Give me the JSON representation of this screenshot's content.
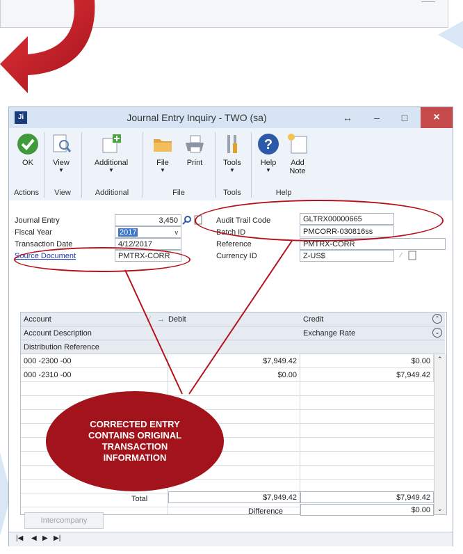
{
  "window": {
    "title": "Journal Entry Inquiry  -  TWO (sa)",
    "app_icon": "Ji",
    "controls": {
      "resize": "↔",
      "minimize": "–",
      "maximize": "□",
      "close": "×"
    }
  },
  "ribbon": {
    "items": [
      {
        "id": "ok",
        "label": "OK",
        "icon": "checkmark-icon"
      },
      {
        "id": "view",
        "label": "View",
        "icon": "magnifier-document-icon"
      },
      {
        "id": "additional",
        "label": "Additional",
        "icon": "window-plus-icon"
      },
      {
        "id": "file",
        "label": "File",
        "icon": "folder-icon"
      },
      {
        "id": "print",
        "label": "Print",
        "icon": "printer-icon"
      },
      {
        "id": "tools",
        "label": "Tools",
        "icon": "tools-icon"
      },
      {
        "id": "help",
        "label": "Help",
        "icon": "question-icon"
      },
      {
        "id": "add_note",
        "label": "Add",
        "label2": "Note",
        "icon": "note-icon"
      }
    ],
    "groups": [
      "Actions",
      "View",
      "Additional",
      "File",
      "Tools",
      "Help"
    ]
  },
  "form": {
    "journal_entry_label": "Journal Entry",
    "journal_entry_value": "3,450",
    "fiscal_year_label": "Fiscal Year",
    "fiscal_year_value": "2017",
    "transaction_date_label": "Transaction Date",
    "transaction_date_value": "4/12/2017",
    "source_document_label": "Source Document",
    "source_document_value": "PMTRX-CORR",
    "audit_trail_label": "Audit Trail Code",
    "audit_trail_value": "GLTRX00000665",
    "batch_id_label": "Batch ID",
    "batch_id_value": "PMCORR-030816ss",
    "reference_label": "Reference",
    "reference_value": "PMTRX-CORR",
    "currency_label": "Currency ID",
    "currency_value": "Z-US$"
  },
  "grid": {
    "headers": {
      "account": "Account",
      "debit": "Debit",
      "credit": "Credit",
      "account_description": "Account Description",
      "exchange_rate": "Exchange Rate",
      "distribution_reference": "Distribution Reference"
    },
    "rows": [
      {
        "account": "000 -2300 -00",
        "debit": "$7,949.42",
        "credit": "$0.00"
      },
      {
        "account": "000 -2310 -00",
        "debit": "$0.00",
        "credit": "$7,949.42"
      }
    ],
    "total_label": "Total",
    "total_debit": "$7,949.42",
    "total_credit": "$7,949.42",
    "difference_label": "Difference",
    "difference_value": "$0.00"
  },
  "intercompany_label": "Intercompany",
  "annotation": {
    "callout_line1": "CORRECTED ENTRY",
    "callout_line2": "CONTAINS ORIGINAL",
    "callout_line3": "TRANSACTION",
    "callout_line4": "INFORMATION",
    "highlight_color": "#b5121b"
  },
  "colors": {
    "accent": "#3f76c8",
    "close_button": "#c74a4a",
    "callout": "#a3131b"
  }
}
